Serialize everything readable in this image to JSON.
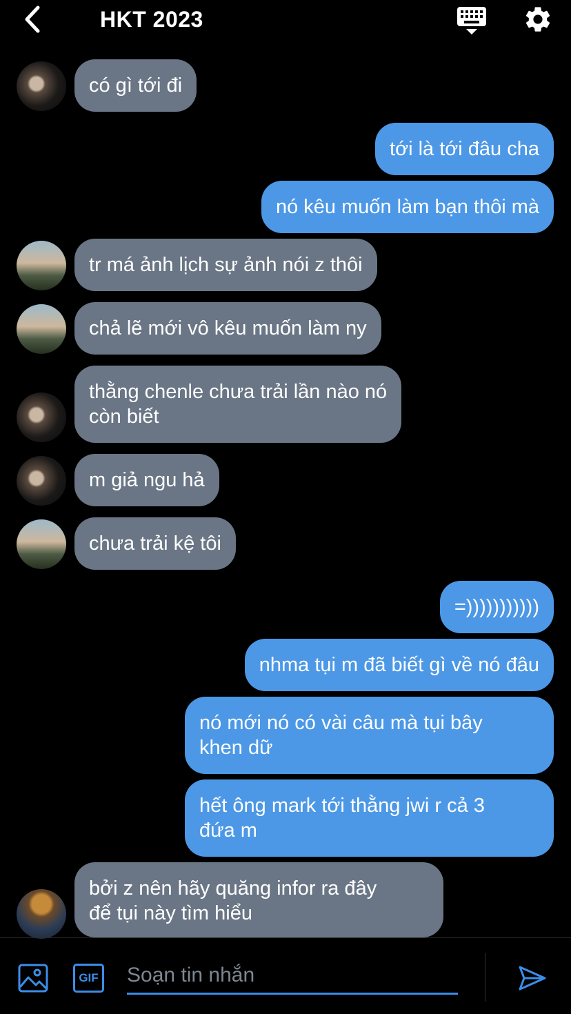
{
  "header": {
    "title": "HKT 2023",
    "icons": {
      "back": "back-chevron-icon",
      "keyboard": "keyboard-icon",
      "settings": "gear-icon"
    }
  },
  "colors": {
    "incoming_bubble": "#6a7685",
    "outgoing_bubble": "#4c98e6",
    "accent": "#3b8ee8",
    "background": "#000000"
  },
  "messages": [
    {
      "direction": "in",
      "sender_avatar": "avatar-dark",
      "lines": [
        "có gì tới đi"
      ]
    },
    {
      "direction": "out",
      "lines": [
        "tới là tới đâu cha"
      ]
    },
    {
      "direction": "out",
      "lines": [
        "nó kêu muốn làm bạn thôi mà"
      ]
    },
    {
      "direction": "in",
      "sender_avatar": "avatar-sky",
      "lines": [
        "tr má ảnh lịch sự ảnh nói z thôi"
      ]
    },
    {
      "direction": "in",
      "sender_avatar": "avatar-sky",
      "lines": [
        "chả lẽ mới vô kêu muốn làm ny"
      ]
    },
    {
      "direction": "in",
      "sender_avatar": "avatar-dark",
      "lines": [
        "thằng chenle chưa trải lần nào nó",
        "còn biết"
      ]
    },
    {
      "direction": "in",
      "sender_avatar": "avatar-dark",
      "lines": [
        "m giả ngu hả"
      ]
    },
    {
      "direction": "in",
      "sender_avatar": "avatar-sky",
      "lines": [
        "chưa trải kệ tôi"
      ]
    },
    {
      "direction": "out",
      "lines": [
        "=)))))))))))"
      ]
    },
    {
      "direction": "out",
      "lines": [
        "nhma tụi m đã biết gì về nó đâu"
      ]
    },
    {
      "direction": "out",
      "lines": [
        "nó mới nó có vài câu mà tụi bây",
        "khen dữ"
      ]
    },
    {
      "direction": "out",
      "lines": [
        "hết ông mark tới thằng jwi r cả 3",
        "đứa m"
      ]
    },
    {
      "direction": "in",
      "sender_avatar": "avatar-hat",
      "lines": [
        "bởi z nên hãy quăng infor ra đây",
        "để tụi này tìm hiểu"
      ]
    }
  ],
  "composer": {
    "placeholder": "Soạn tin nhắn",
    "value": "",
    "gif_label": "GIF",
    "icons": {
      "image": "image-icon",
      "gif": "gif-icon",
      "send": "send-icon"
    }
  }
}
